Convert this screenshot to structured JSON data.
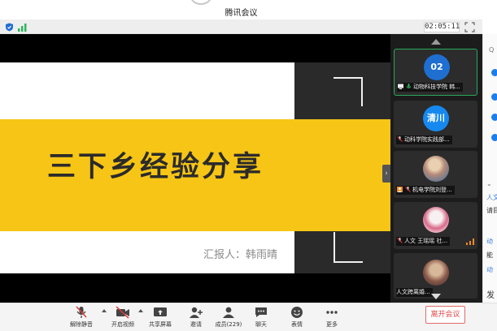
{
  "window": {
    "title": "腾讯会议"
  },
  "status": {
    "timer": "02:05:11"
  },
  "slide": {
    "title": "三下乡经验分享",
    "presenter": "汇报人：韩雨晴"
  },
  "participants": [
    {
      "avatar_text": "02",
      "label": "动物科技学院 韩..."
    },
    {
      "avatar_text": "清川",
      "label": "动科学院实践部..."
    },
    {
      "avatar_text": "",
      "label": "机电学院刘登..."
    },
    {
      "avatar_text": "",
      "label": "人文 王瑶瑶 社..."
    },
    {
      "avatar_text": "",
      "label": "人文跨离婚..."
    }
  ],
  "right_panel": {
    "search_glyph": "Q",
    "lines": [
      "人文",
      "请目",
      "动",
      "能",
      "动",
      "发"
    ]
  },
  "toolbar": {
    "mute": "解除静音",
    "video": "开启视频",
    "share": "共享屏幕",
    "invite": "邀请",
    "members": "成员(229)",
    "chat": "聊天",
    "reactions": "表情",
    "more": "更多",
    "leave": "离开会议"
  },
  "colors": {
    "slide_yellow": "#f6c516",
    "accent_blue": "#1f6fd0",
    "leave_red": "#e04848",
    "mic_muted_red": "#e03a3a"
  }
}
